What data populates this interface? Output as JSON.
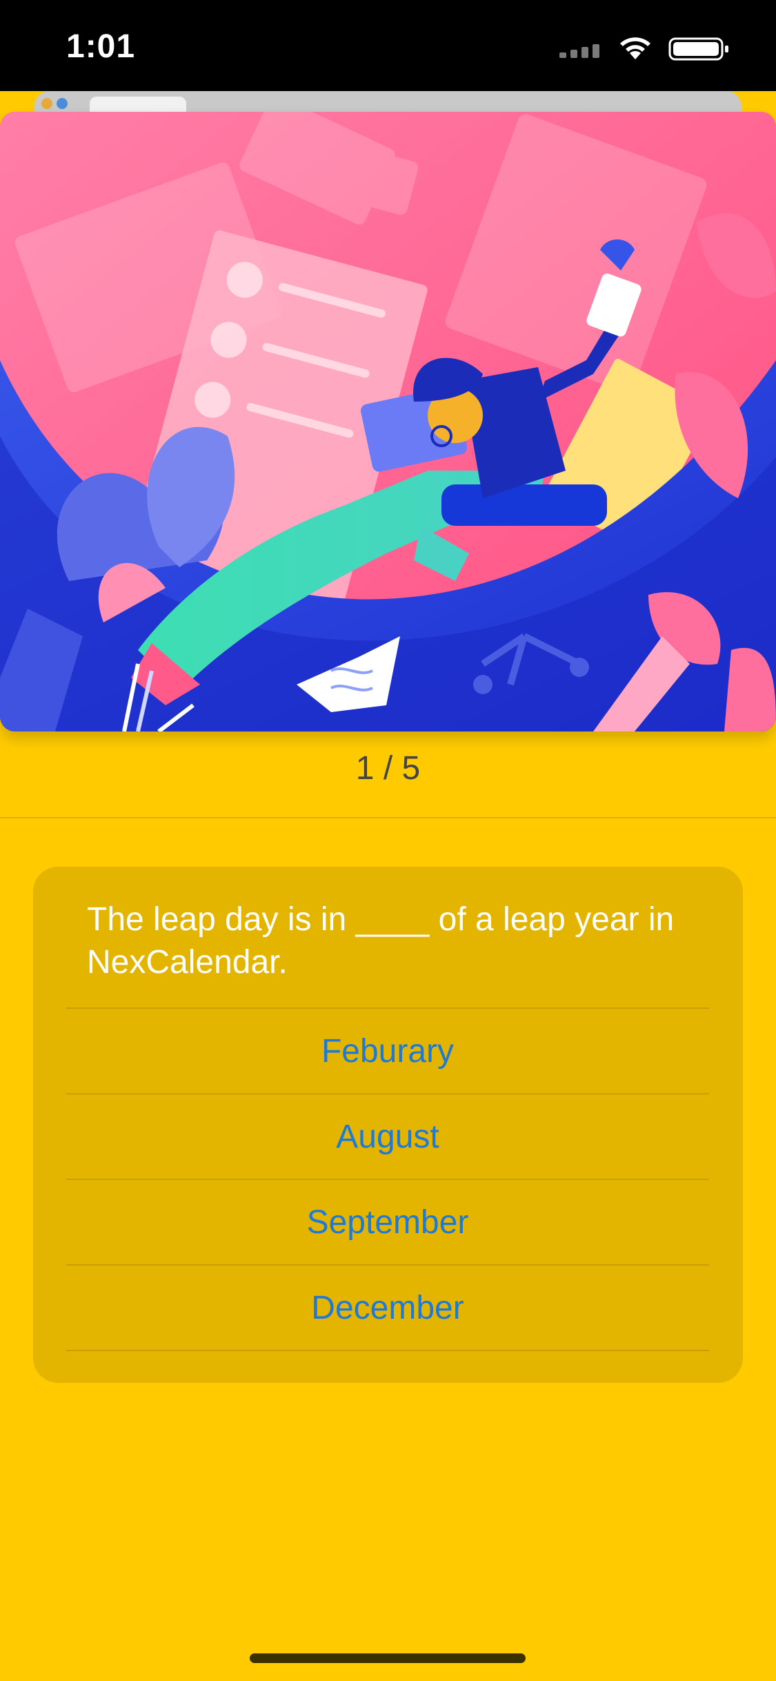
{
  "status_bar": {
    "time": "1:01"
  },
  "quiz": {
    "progress": "1 / 5",
    "question": "The leap day is in ____ of a leap year in NexCalendar.",
    "answers": [
      "Feburary",
      "August",
      "September",
      "December"
    ]
  },
  "colors": {
    "background": "#FFCB00",
    "card": "#E3B500",
    "answer_text": "#1E7AD6",
    "hero_pink": "#FF5A8A",
    "hero_blue": "#2B44E0"
  }
}
